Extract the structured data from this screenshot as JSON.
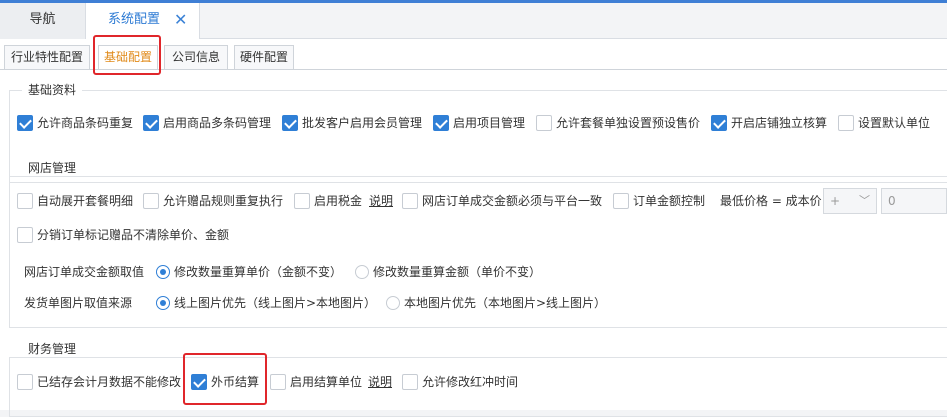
{
  "main_tabs": {
    "nav": "导航",
    "active": "系统配置"
  },
  "sub_tabs": [
    "行业特性配置",
    "基础配置",
    "公司信息",
    "硬件配置"
  ],
  "basic": {
    "title": "基础资料",
    "items": [
      {
        "label": "允许商品条码重复",
        "checked": true
      },
      {
        "label": "启用商品多条码管理",
        "checked": true
      },
      {
        "label": "批发客户启用会员管理",
        "checked": true
      },
      {
        "label": "启用项目管理",
        "checked": true
      },
      {
        "label": "允许套餐单独设置预设售价",
        "checked": false
      },
      {
        "label": "开启店铺独立核算",
        "checked": true
      },
      {
        "label": "设置默认单位",
        "checked": false
      }
    ]
  },
  "online": {
    "title": "网店管理",
    "row1": [
      {
        "label": "自动展开套餐明细",
        "checked": false
      },
      {
        "label": "允许赠品规则重复执行",
        "checked": false
      },
      {
        "label": "启用税金",
        "checked": false
      },
      {
        "label": "网店订单成交金额必须与平台一致",
        "checked": false
      },
      {
        "label": "订单金额控制",
        "checked": false
      }
    ],
    "tax_link": "说明",
    "min_price_label": "最低价格 = 成本价",
    "op_select": "+",
    "amount_value": "0",
    "row2": {
      "label": "分销订单标记赠品不清除单价、金额",
      "checked": false
    },
    "amount_value_label": "网店订单成交金额取值",
    "amount_options": [
      {
        "label": "修改数量重算单价（金额不变）",
        "selected": true
      },
      {
        "label": "修改数量重算金额（单价不变）",
        "selected": false
      }
    ],
    "image_source_label": "发货单图片取值来源",
    "image_options": [
      {
        "label": "线上图片优先（线上图片>本地图片）",
        "selected": true
      },
      {
        "label": "本地图片优先（本地图片>线上图片）",
        "selected": false
      }
    ]
  },
  "finance": {
    "title": "财务管理",
    "items": [
      {
        "label": "已结存会计月数据不能修改",
        "checked": false
      },
      {
        "label": "外币结算",
        "checked": true
      },
      {
        "label": "启用结算单位",
        "checked": false
      },
      {
        "label": "允许修改红冲时间",
        "checked": false
      }
    ],
    "unit_link": "说明"
  }
}
